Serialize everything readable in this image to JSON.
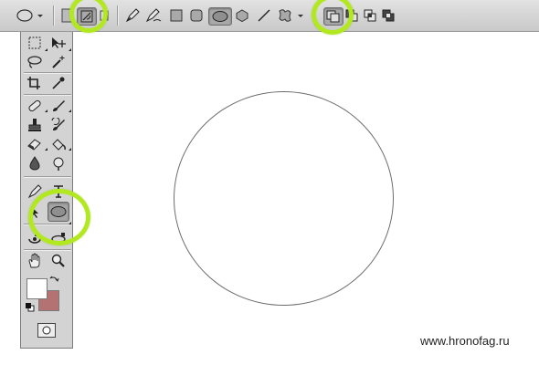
{
  "options_bar": {
    "tool_preset_icon": "ellipse-tool-icon",
    "mode_buttons": [
      "shape-layers-icon",
      "paths-icon",
      "fill-pixels-icon"
    ],
    "drawing_tools": [
      "pen-icon",
      "freeform-pen-icon",
      "rectangle-icon",
      "rounded-rectangle-icon",
      "ellipse-icon",
      "polygon-icon",
      "line-icon",
      "custom-shape-icon"
    ],
    "selected_mode": "paths",
    "selected_shape": "ellipse",
    "path_operations": [
      "add-to-path-area-icon",
      "subtract-from-path-area-icon",
      "intersect-path-areas-icon",
      "exclude-overlapping-path-areas-icon"
    ],
    "selected_operation": "add-to-path-area"
  },
  "tools_panel": {
    "active_tool": "ellipse-tool",
    "foreground_color": "#ffffff",
    "background_color": "#b47272"
  },
  "highlight_color": "#b2e81f",
  "watermark": "www.hronofag.ru"
}
